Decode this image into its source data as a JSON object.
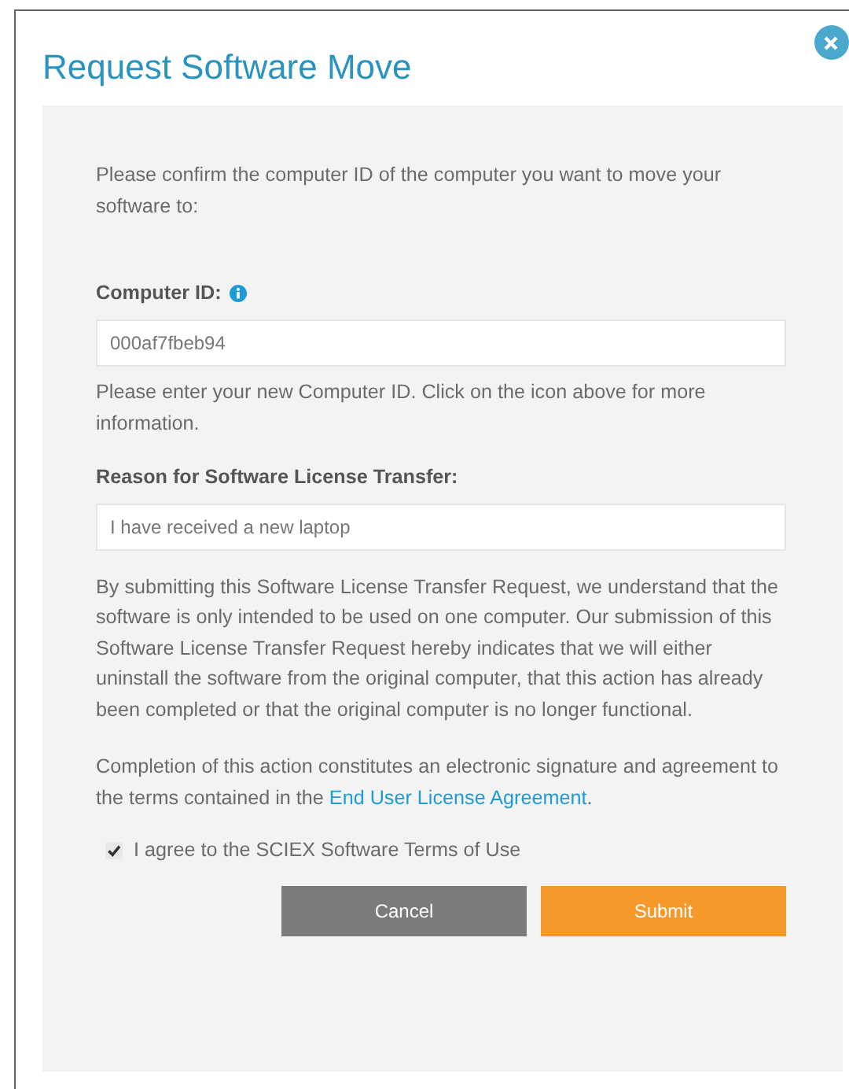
{
  "dialog": {
    "title": "Request Software Move",
    "intro": "Please confirm the computer ID of the computer you want to move your software to:",
    "computer_id": {
      "label": "Computer ID:",
      "value": "000af7fbeb94",
      "help": "Please enter your new Computer ID. Click on the icon above for more information."
    },
    "reason": {
      "label": "Reason for Software License Transfer:",
      "value": "I have received a new laptop"
    },
    "statement": "By submitting this Software License Transfer Request, we understand that the software is only intended to be used on one computer. Our submission of this Software License Transfer Request hereby indicates that we will either uninstall the software from the original computer, that this action has already been completed or that the original computer is no longer functional.",
    "signature": {
      "text": "Completion of this action constitutes an electronic signature and agreement to the terms contained in the ",
      "link": "End User License Agreement",
      "after": "."
    },
    "agree": {
      "label": "I agree to the SCIEX Software Terms of Use",
      "checked": true
    },
    "buttons": [
      {
        "label": "Cancel",
        "kind": "secondary"
      },
      {
        "label": "Submit",
        "kind": "primary"
      }
    ]
  }
}
